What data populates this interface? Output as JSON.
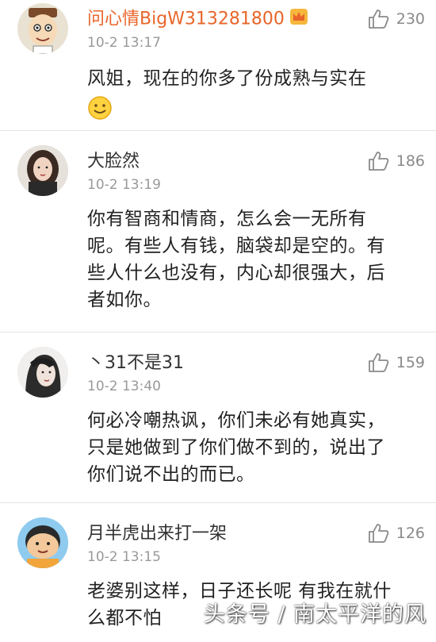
{
  "colors": {
    "vip_name": "#e8652a",
    "normal_name": "#333333",
    "meta": "#999999",
    "text": "#222222"
  },
  "comments": [
    {
      "name": "问心情BigW313281800",
      "vip": true,
      "time": "10-2 13:17",
      "likes": "230",
      "avatar": "cartoon-character-avatar",
      "text": [
        "风姐，现在的你多了份成熟与实在"
      ],
      "emoji": "smile-emoji"
    },
    {
      "name": "大脸然",
      "vip": false,
      "time": "10-2 13:19",
      "likes": "186",
      "avatar": "woman-photo-avatar",
      "text": [
        "你有智商和情商，怎么会一无所有",
        "呢。有些人有钱，脑袋却是空的。有",
        "些人什么也没有，内心却很强大，后",
        "者如你。"
      ]
    },
    {
      "name": "丶31不是31",
      "vip": false,
      "time": "10-2 13:40",
      "likes": "159",
      "avatar": "woman-face-avatar",
      "text": [
        "何必冷嘲热讽，你们未必有她真实，",
        "只是她做到了你们做不到的，说出了",
        "你们说不出的而已。"
      ]
    },
    {
      "name": "月半虎出来打一架",
      "vip": false,
      "time": "10-2 13:15",
      "likes": "126",
      "avatar": "cartoon-boy-avatar",
      "text": [
        "老婆别这样，日子还长呢 有我在就什",
        "么都不怕"
      ]
    }
  ],
  "watermark": "头条号 / 南太平洋的风"
}
